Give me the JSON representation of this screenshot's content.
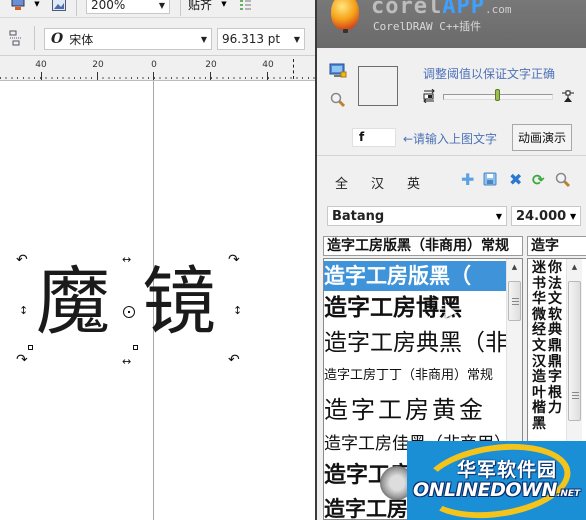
{
  "toolbar": {
    "zoom_level": "200%",
    "snap_label": "贴齐",
    "font_name": "宋体",
    "font_style_glyph": "O",
    "font_size": "96.313 pt",
    "icons": [
      "view-icon",
      "dropdown-arrow-icon",
      "image-icon",
      "snap-options-icon",
      "align-icon"
    ]
  },
  "ruler": {
    "labels": [
      "40",
      "20",
      "0",
      "20",
      "40"
    ]
  },
  "canvas": {
    "text": [
      "魔",
      "镜"
    ]
  },
  "plugin": {
    "brand_main": "corel",
    "brand_highlight": "APP",
    "brand_domain": ".com",
    "brand_sub": "CorelDRAW C++插件",
    "threshold_hint": "调整阈值以保证文字正确",
    "threshold_value": 0.5,
    "input_value": "f",
    "input_hint": "←请输入上图文字",
    "demo_button": "动画演示",
    "filter_tabs": [
      "全",
      "汉",
      "英"
    ],
    "action_icons": [
      "add-icon",
      "save-icon",
      "delete-icon",
      "refresh-icon",
      "search-icon"
    ],
    "font_select": "Batang",
    "size_select": "24.000",
    "font_list_header": "造字工房版黑（非商用）常规",
    "font_list": [
      {
        "label": "造字工房版黑（",
        "selected": true
      },
      {
        "label": "造字工房博黑",
        "selected": false
      },
      {
        "label": "造字工房典黑（非",
        "selected": false
      },
      {
        "label": "造字工房丁丁（非商用）常规",
        "selected": false
      },
      {
        "label": "造字工房黄金",
        "selected": false
      },
      {
        "label": "造字工房佳黑（非商用）常",
        "selected": false
      },
      {
        "label": "造字工房",
        "selected": false
      },
      {
        "label": "造字工房",
        "selected": false
      }
    ],
    "char_list_header": "造字",
    "char_col1": "迷书华微经文汉造叶楷黑",
    "char_col2": "你法文软典鼎鼎字根力"
  },
  "watermark": {
    "cn": "华军软件园",
    "en": "ONLINEDOWN",
    "net": ".NET"
  }
}
